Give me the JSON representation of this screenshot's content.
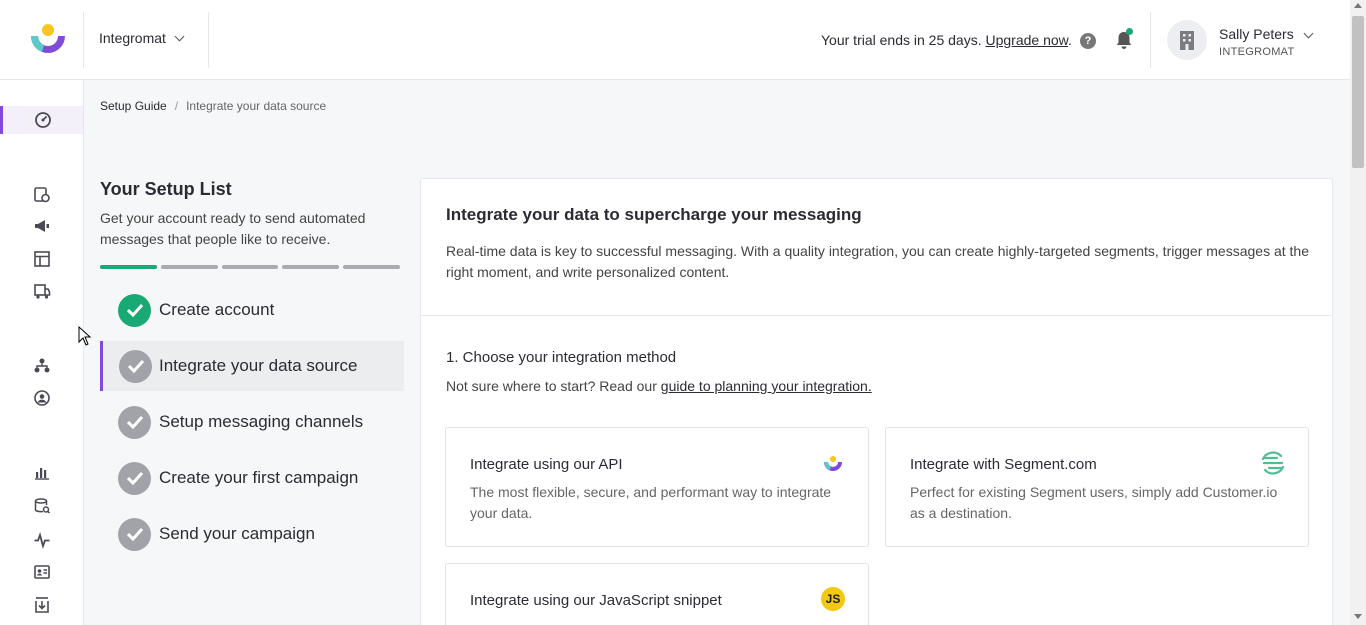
{
  "header": {
    "workspace": "Integromat",
    "trial_text": "Your trial ends in 25 days.",
    "upgrade_link": "Upgrade now",
    "trial_suffix": ".",
    "help_glyph": "?",
    "user_name": "Sally Peters",
    "user_org": "INTEGROMAT"
  },
  "sidebar": {
    "items": [
      {
        "icon": "dashboard-icon",
        "active": true
      },
      {
        "icon": "campaigns-icon"
      },
      {
        "icon": "broadcasts-icon"
      },
      {
        "icon": "content-icon"
      },
      {
        "icon": "deliveries-icon"
      },
      {
        "icon": "segments-icon"
      },
      {
        "icon": "people-icon"
      },
      {
        "icon": "analytics-icon"
      },
      {
        "icon": "data-index-icon"
      },
      {
        "icon": "activity-icon"
      },
      {
        "icon": "objects-icon"
      },
      {
        "icon": "import-icon"
      }
    ]
  },
  "breadcrumb": {
    "root": "Setup Guide",
    "separator": "/",
    "current": "Integrate your data source"
  },
  "setup": {
    "title": "Your Setup List",
    "description": "Get your account ready to send automated messages that people like to receive.",
    "progress": {
      "completed": 1,
      "total": 5
    },
    "steps": [
      {
        "label": "Create account",
        "done": true
      },
      {
        "label": "Integrate your data source",
        "done": false,
        "active": true
      },
      {
        "label": "Setup messaging channels",
        "done": false
      },
      {
        "label": "Create your first campaign",
        "done": false
      },
      {
        "label": "Send your campaign",
        "done": false
      }
    ]
  },
  "main": {
    "title": "Integrate your data to supercharge your messaging",
    "description": "Real-time data is key to successful messaging. With a quality integration, you can create highly-targeted segments, trigger messages at the right moment, and write personalized content.",
    "section_title": "1. Choose your integration method",
    "section_sub": "Not sure where to start? Read our ",
    "section_link": "guide to planning your integration.",
    "cards": [
      {
        "title": "Integrate using our API",
        "description": "The most flexible, secure, and performant way to integrate your data.",
        "icon": "customerio-logo-icon"
      },
      {
        "title": "Integrate with Segment.com",
        "description": "Perfect for existing Segment users, simply add Customer.io as a destination.",
        "icon": "segment-logo-icon"
      },
      {
        "title": "Integrate using our JavaScript snippet",
        "description": "",
        "icon": "javascript-icon",
        "badge": "JS"
      }
    ]
  },
  "colors": {
    "accent": "#7f4bd8",
    "success": "#19a974",
    "neutral_check": "#a1a3a8"
  }
}
